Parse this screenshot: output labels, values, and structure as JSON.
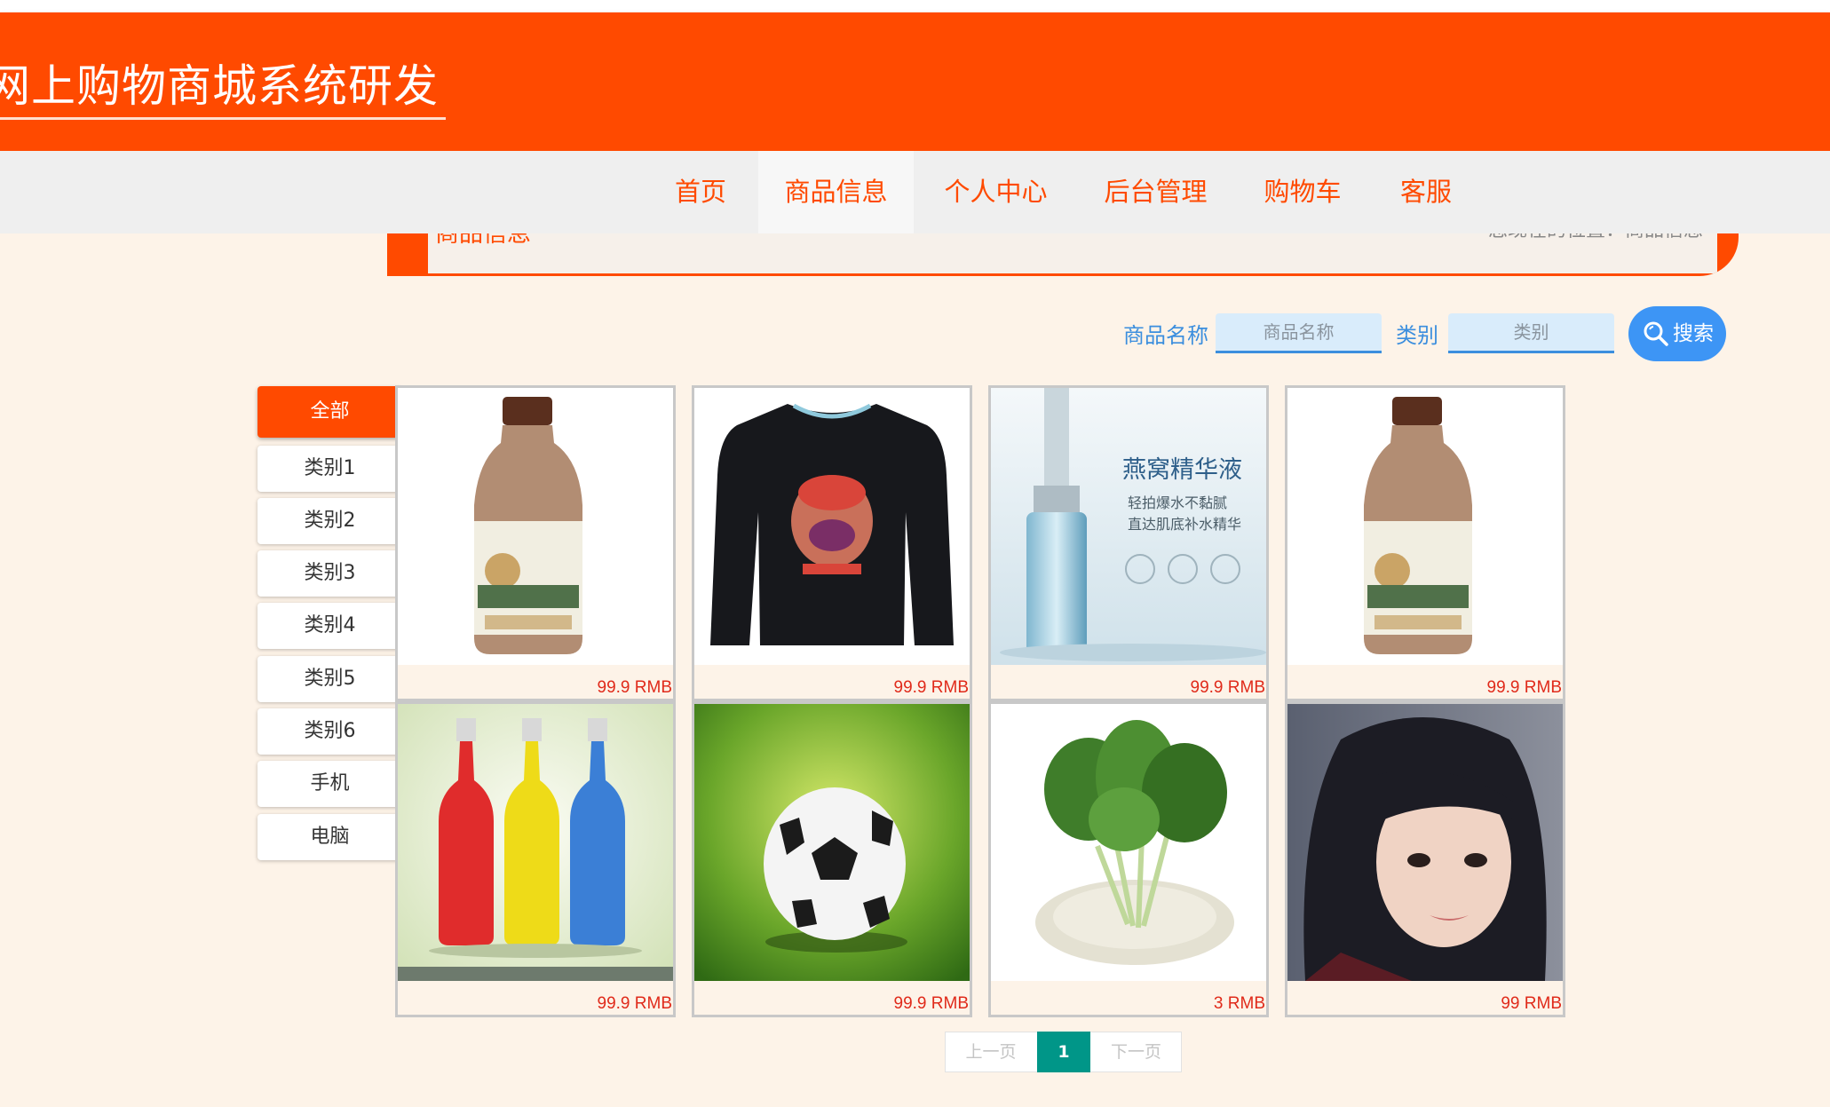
{
  "header": {
    "title": "网上购物商城系统研发"
  },
  "nav": {
    "items": [
      {
        "label": "首页"
      },
      {
        "label": "商品信息"
      },
      {
        "label": "个人中心"
      },
      {
        "label": "后台管理"
      },
      {
        "label": "购物车"
      },
      {
        "label": "客服"
      }
    ],
    "active": "商品信息"
  },
  "breadcrumb": {
    "title": "商品信息",
    "location": "您现在的位置：商品信息"
  },
  "search": {
    "name_label": "商品名称",
    "name_placeholder": "商品名称",
    "category_label": "类别",
    "category_placeholder": "类别",
    "button_label": "搜索",
    "button_icon": "search-icon",
    "button_color": "#3d95f5"
  },
  "categories": [
    {
      "label": "全部"
    },
    {
      "label": "类别1"
    },
    {
      "label": "类别2"
    },
    {
      "label": "类别3"
    },
    {
      "label": "类别4"
    },
    {
      "label": "类别5"
    },
    {
      "label": "类别6"
    },
    {
      "label": "手机"
    },
    {
      "label": "电脑"
    }
  ],
  "products": [
    {
      "image": "milk-coffee-bottle",
      "price": "99.9 RMB"
    },
    {
      "image": "black-chopper-tshirt",
      "price": "99.9 RMB"
    },
    {
      "image": "birds-nest-serum",
      "price": "99.9 RMB",
      "image_text": [
        "燕窝精华液",
        "轻拍爆水不黏腻",
        "直达肌底补水精华"
      ]
    },
    {
      "image": "milk-coffee-bottle",
      "price": "99.9 RMB"
    },
    {
      "image": "three-colored-bottles",
      "price": "99.9 RMB"
    },
    {
      "image": "soccer-ball",
      "price": "99.9 RMB"
    },
    {
      "image": "green-vegetables",
      "price": "3 RMB"
    },
    {
      "image": "girl-portrait",
      "price": "99 RMB"
    }
  ],
  "pagination": {
    "prev": "上一页",
    "current": "1",
    "next": "下一页"
  },
  "colors": {
    "brand": "#ff4a00",
    "price": "#e02a1a",
    "link": "#3b8ede",
    "page_active": "#009688",
    "background": "#fdf3e8"
  }
}
